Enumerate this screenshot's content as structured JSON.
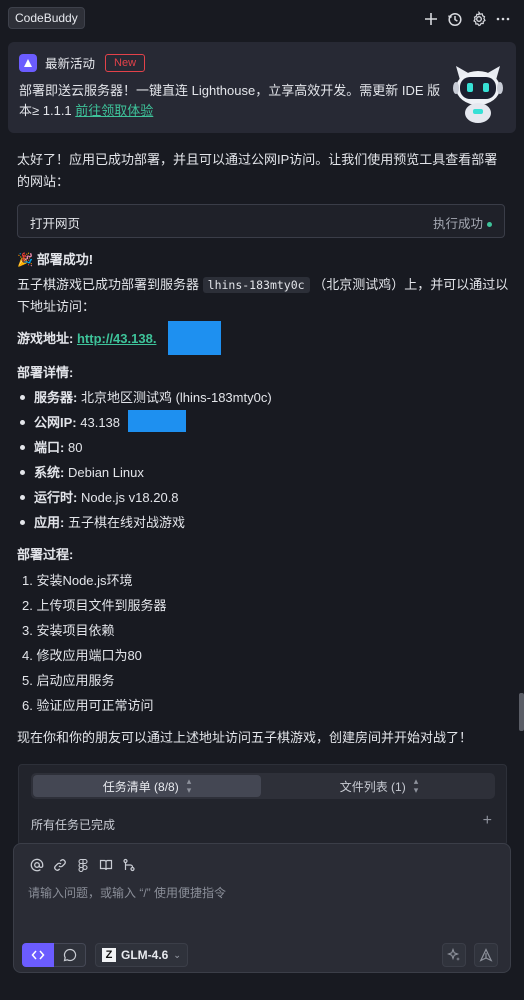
{
  "app": {
    "badge": "CodeBuddy"
  },
  "top_icons": [
    "plus-icon",
    "history-icon",
    "gear-icon",
    "more-icon"
  ],
  "news": {
    "title": "最新活动",
    "badge": "New",
    "text": "部署即送云服务器！一键直连 Lighthouse，立享高效开发。需更新 IDE 版本≥ 1.1.1 ",
    "link": "前往领取体验"
  },
  "message": {
    "intro": "太好了！应用已成功部署，并且可以通过公网IP访问。让我们使用预览工具查看部署的网站：",
    "tool": {
      "name": "打开网页",
      "status": "执行成功"
    },
    "success_title": "🎉 部署成功!",
    "deploy_text_pre": "五子棋游戏已成功部署到服务器",
    "server_code": "lhins-183mty0c",
    "deploy_text_post": "（北京测试鸡）上，并可以通过以下地址访问：",
    "address_label": "游戏地址:",
    "address_link": "http://43.138.",
    "details_title": "部署详情:",
    "details": [
      {
        "label": "服务器:",
        "value": "北京地区测试鸡 (lhins-183mty0c)"
      },
      {
        "label": "公网IP:",
        "value": "43.138"
      },
      {
        "label": "端口:",
        "value": "80"
      },
      {
        "label": "系统:",
        "value": "Debian Linux"
      },
      {
        "label": "运行时:",
        "value": "Node.js v18.20.8"
      },
      {
        "label": "应用:",
        "value": "五子棋在线对战游戏"
      }
    ],
    "process_title": "部署过程:",
    "steps": [
      "1. 安装Node.js环境",
      "2. 上传项目文件到服务器",
      "3. 安装项目依赖",
      "4. 修改应用端口为80",
      "5. 启动应用服务",
      "6. 验证应用可正常访问"
    ],
    "closing": "现在你和你的朋友可以通过上述地址访问五子棋游戏，创建房间并开始对战了！"
  },
  "panel": {
    "tabs": [
      "任务清单 (8/8)",
      "文件列表 (1)"
    ],
    "status": "所有任务已完成"
  },
  "composer": {
    "icons": [
      "at-icon",
      "link-icon",
      "figma-icon",
      "book-icon",
      "branch-icon"
    ],
    "placeholder": "请输入问题，或输入 “/” 使用便捷指令",
    "model": "GLM-4.6",
    "model_logo": "Z"
  },
  "colors": {
    "accent": "#6b5cff",
    "link": "#3ec39a",
    "new_badge": "#e3424a",
    "redaction": "#1e90f0"
  }
}
